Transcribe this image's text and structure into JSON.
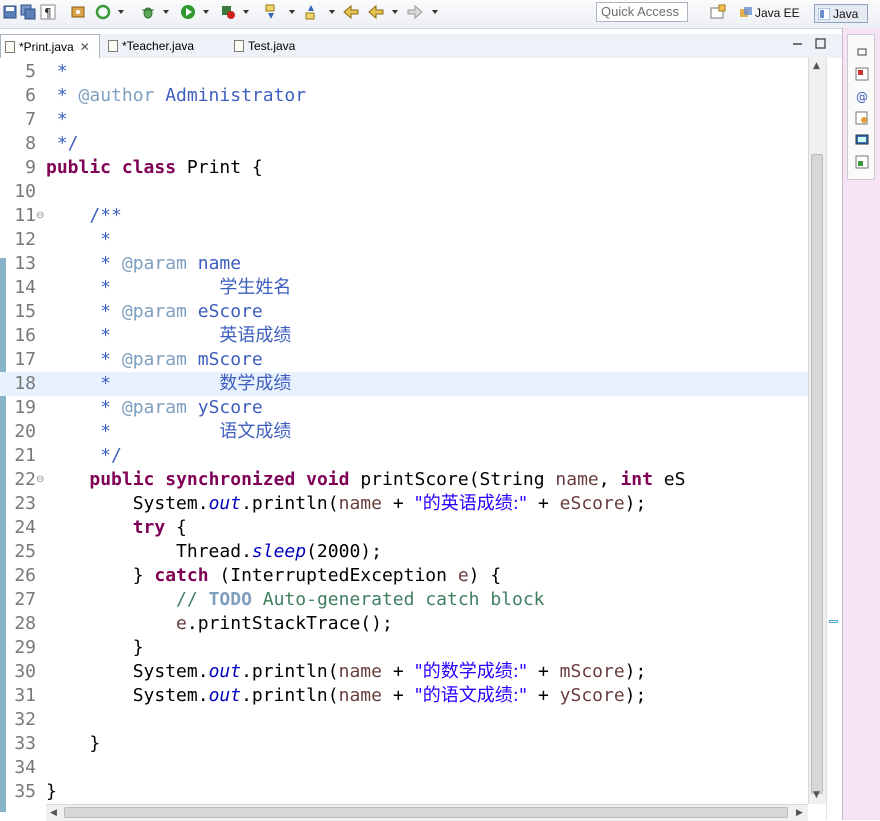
{
  "toolbar": {
    "quick_access_placeholder": "Quick Access",
    "perspectives": [
      {
        "label": "Java EE",
        "icon": "java-ee-perspective-icon",
        "active": false
      },
      {
        "label": "Java",
        "icon": "java-perspective-icon",
        "active": true
      }
    ],
    "icons": [
      "save-icon",
      "save-all-icon",
      "show-whitespace-icon",
      "new-java-project-icon",
      "refresh-icon",
      "debug-icon",
      "run-icon",
      "external-tools-icon",
      "next-annotation-icon",
      "previous-annotation-icon",
      "last-edit-icon",
      "back-icon",
      "forward-icon",
      "open-perspective-icon"
    ]
  },
  "tabs": [
    {
      "label": "*Print.java",
      "active": true,
      "close": "✕"
    },
    {
      "label": "*Teacher.java",
      "active": false
    },
    {
      "label": "Test.java",
      "active": false
    }
  ],
  "editor": {
    "current_line": 18,
    "lines": [
      {
        "n": "5"
      },
      {
        "n": "6"
      },
      {
        "n": "7"
      },
      {
        "n": "8"
      },
      {
        "n": "9"
      },
      {
        "n": "10"
      },
      {
        "n": "11",
        "fold": "⊖"
      },
      {
        "n": "12"
      },
      {
        "n": "13"
      },
      {
        "n": "14"
      },
      {
        "n": "15"
      },
      {
        "n": "16"
      },
      {
        "n": "17"
      },
      {
        "n": "18"
      },
      {
        "n": "19"
      },
      {
        "n": "20"
      },
      {
        "n": "21"
      },
      {
        "n": "22",
        "fold": "⊖"
      },
      {
        "n": "23"
      },
      {
        "n": "24"
      },
      {
        "n": "25"
      },
      {
        "n": "26"
      },
      {
        "n": "27"
      },
      {
        "n": "28"
      },
      {
        "n": "29"
      },
      {
        "n": "30"
      },
      {
        "n": "31"
      },
      {
        "n": "32"
      },
      {
        "n": "33"
      },
      {
        "n": "34"
      },
      {
        "n": "35"
      }
    ],
    "code": {
      "l5": [
        " *"
      ],
      "l6": [
        " * ",
        "@author",
        " Administrator"
      ],
      "l7": [
        " *"
      ],
      "l8": [
        " */"
      ],
      "l9": [
        "public",
        " ",
        "class",
        " Print {"
      ],
      "l11": [
        "    /**"
      ],
      "l12": [
        "     *"
      ],
      "l13": [
        "     * ",
        "@param",
        " name"
      ],
      "l14": [
        "     *          ",
        "学生姓名"
      ],
      "l15": [
        "     * ",
        "@param",
        " eScore"
      ],
      "l16": [
        "     *          ",
        "英语成绩"
      ],
      "l17": [
        "     * ",
        "@param",
        " mScore"
      ],
      "l18": [
        "     *          ",
        "数学成绩"
      ],
      "l19": [
        "     * ",
        "@param",
        " yScore"
      ],
      "l20": [
        "     *          ",
        "语文成绩"
      ],
      "l21": [
        "     */"
      ],
      "l22": [
        "    ",
        "public",
        " ",
        "synchronized",
        " ",
        "void",
        " printScore(String ",
        "name",
        ", ",
        "int",
        " eS"
      ],
      "l23": [
        "        System.",
        "out",
        ".println(",
        "name",
        " + ",
        "\"的英语成绩:\"",
        " + ",
        "eScore",
        ");"
      ],
      "l24": [
        "        ",
        "try",
        " {"
      ],
      "l25": [
        "            Thread.",
        "sleep",
        "(2000);"
      ],
      "l26": [
        "        } ",
        "catch",
        " (InterruptedException ",
        "e",
        ") {"
      ],
      "l27": [
        "            ",
        "// ",
        "TODO",
        " Auto-generated catch block"
      ],
      "l28": [
        "            ",
        "e",
        ".printStackTrace();"
      ],
      "l29": [
        "        }"
      ],
      "l30": [
        "        System.",
        "out",
        ".println(",
        "name",
        " + ",
        "\"的数学成绩:\"",
        " + ",
        "mScore",
        ");"
      ],
      "l31": [
        "        System.",
        "out",
        ".println(",
        "name",
        " + ",
        "\"的语文成绩:\"",
        " + ",
        "yScore",
        ");"
      ],
      "l33": [
        "    }"
      ],
      "l35": [
        "}"
      ]
    }
  },
  "side_panel": {
    "icons": [
      "minimize-icon",
      "package-explorer-icon",
      "javadoc-icon",
      "declaration-icon",
      "console-icon",
      "outline-icon"
    ]
  },
  "colors": {
    "keyword": "#7f0055",
    "javadoc": "#3f5fbf",
    "javadoc_tag": "#7f9fbf",
    "string": "#2a00ff",
    "comment": "#3f7f5f",
    "static_field": "#0000c0",
    "param": "#6a3e3e",
    "line_number": "#787878",
    "side_panel_bg": "#f6e3f4"
  }
}
